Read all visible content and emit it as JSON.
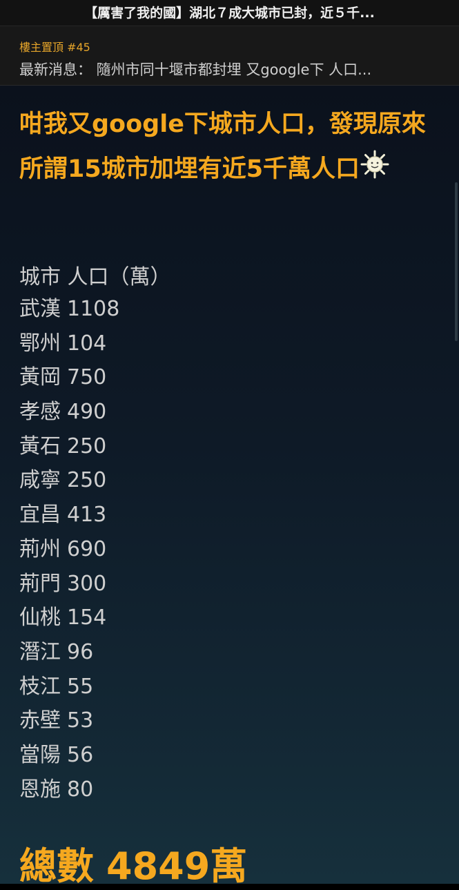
{
  "topbar": {
    "title": "【厲害了我的國】湖北７成大城市已封，近５千..."
  },
  "pinned": {
    "label": "樓主置頂 #45",
    "news": "最新消息： 隨州市同十堰市都封埋 又google下 人口..."
  },
  "post": {
    "headline": "咁我又google下城市人口，發現原來所謂15城市加埋有近5千萬人口",
    "emoji_icon": "sun-icon",
    "table_header": "城市 人口（萬）",
    "cities": [
      {
        "name": "武漢",
        "population": "1108"
      },
      {
        "name": "鄂州",
        "population": "104"
      },
      {
        "name": "黃岡",
        "population": "750"
      },
      {
        "name": "孝感",
        "population": "490"
      },
      {
        "name": "黃石",
        "population": "250"
      },
      {
        "name": "咸寧",
        "population": "250"
      },
      {
        "name": "宜昌",
        "population": "413"
      },
      {
        "name": "荊州",
        "population": "690"
      },
      {
        "name": "荊門",
        "population": "300"
      },
      {
        "name": "仙桃",
        "population": "154"
      },
      {
        "name": "潛江",
        "population": "96"
      },
      {
        "name": "枝江",
        "population": "55"
      },
      {
        "name": "赤壁",
        "population": "53"
      },
      {
        "name": "當陽",
        "population": "56"
      },
      {
        "name": "恩施",
        "population": "80"
      }
    ],
    "total_label": "總數",
    "total_value": "4849萬"
  },
  "colors": {
    "accent": "#f5a81f",
    "pinned_label": "#e6a52a",
    "text": "#cfcfcf",
    "background_top": "#0b111c",
    "background_bottom": "#16303c"
  }
}
